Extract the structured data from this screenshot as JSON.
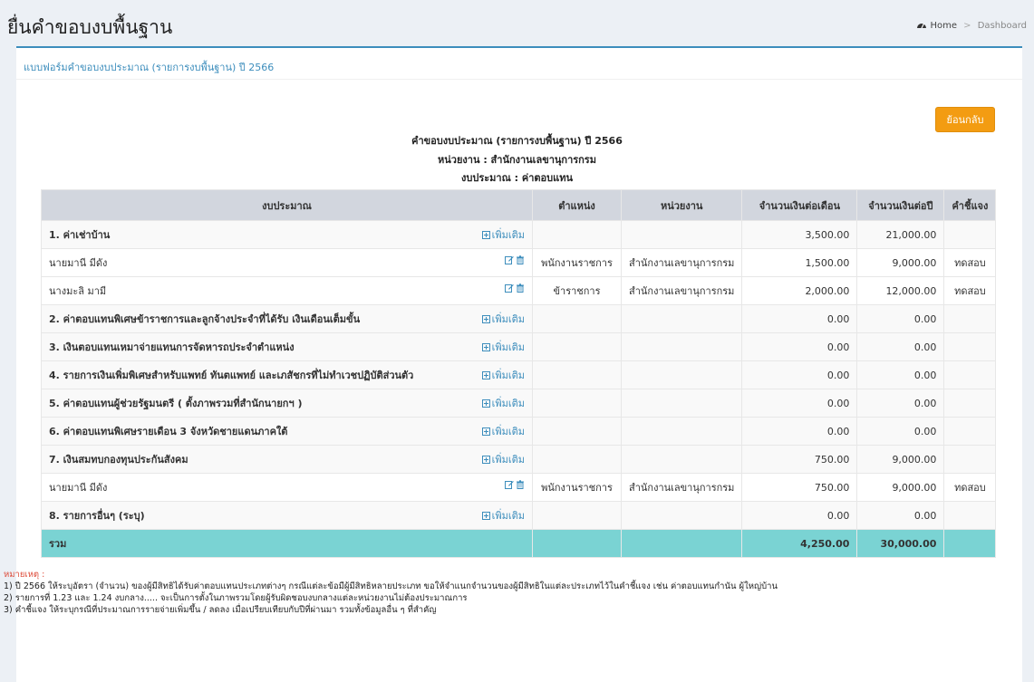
{
  "page": {
    "title": "ยื่นคำขอบงบพื้นฐาน"
  },
  "breadcrumb": {
    "home": "Home",
    "current": "Dashboard"
  },
  "card": {
    "header": "แบบฟอร์มคำขอบงบประมาณ (รายการงบพื้นฐาน) ปี 2566",
    "back_button": "ย้อนกลับ"
  },
  "report": {
    "title": "คำขอบงบประมาณ (รายการงบพื้นฐาน) ปี 2566",
    "unit": "หน่วยงาน : สำนักงานเลขานุการกรม",
    "budget": "งบประมาณ : ค่าตอบแทน"
  },
  "table": {
    "headers": {
      "budget": "งบประมาณ",
      "position": "ตำแหน่ง",
      "unit": "หน่วยงาน",
      "monthly": "จำนวนเงินต่อเดือน",
      "yearly": "จำนวนเงินต่อปี",
      "note": "คำชี้แจง"
    },
    "add_label": "เพิ่มเติม",
    "rows": [
      {
        "name": "1. ค่าเช่าบ้าน",
        "monthly": "3,500.00",
        "yearly": "21,000.00"
      },
      {
        "name": "นายมานี มีดัง",
        "position": "พนักงานราชการ",
        "unit": "สำนักงานเลขานุการกรม",
        "monthly": "1,500.00",
        "yearly": "9,000.00",
        "note": "ทดสอบ"
      },
      {
        "name": "นางมะลิ มามี",
        "position": "ข้าราชการ",
        "unit": "สำนักงานเลขานุการกรม",
        "monthly": "2,000.00",
        "yearly": "12,000.00",
        "note": "ทดสอบ"
      },
      {
        "name": "2. ค่าตอบแทนพิเศษข้าราชการและลูกจ้างประจำที่ได้รับ เงินเดือนเต็มขั้น",
        "monthly": "0.00",
        "yearly": "0.00"
      },
      {
        "name": "3. เงินตอบแทนเหมาจ่ายแทนการจัดหารถประจำตำแหน่ง",
        "monthly": "0.00",
        "yearly": "0.00"
      },
      {
        "name": "4. รายการเงินเพิ่มพิเศษสำหรับแพทย์ ทันตแพทย์ และเภสัชกรที่ไม่ทำเวชปฏิบัติส่วนตัว",
        "monthly": "0.00",
        "yearly": "0.00"
      },
      {
        "name": "5. ค่าตอบแทนผู้ช่วยรัฐมนตรี ( ตั้งภาพรวมที่สำนักนายกฯ )",
        "monthly": "0.00",
        "yearly": "0.00"
      },
      {
        "name": "6. ค่าตอบแทนพิเศษรายเดือน 3 จังหวัดชายแดนภาคใต้",
        "monthly": "0.00",
        "yearly": "0.00"
      },
      {
        "name": "7. เงินสมทบกองทุนประกันสังคม",
        "monthly": "750.00",
        "yearly": "9,000.00"
      },
      {
        "name": "นายมานี มีดัง",
        "position": "พนักงานราชการ",
        "unit": "สำนักงานเลขานุการกรม",
        "monthly": "750.00",
        "yearly": "9,000.00",
        "note": "ทดสอบ"
      },
      {
        "name": "8. รายการอื่นๆ (ระบุ)",
        "monthly": "0.00",
        "yearly": "0.00"
      }
    ],
    "total": {
      "label": "รวม",
      "monthly": "4,250.00",
      "yearly": "30,000.00"
    }
  },
  "notes": {
    "label": "หมายเหตุ :",
    "lines": [
      "1) ปี 2566 ให้ระบุอัตรา (จำนวน) ของผู้มีสิทธิได้รับค่าตอบแทนประเภทต่างๆ กรณีแต่ละข้อมีผู้มีสิทธิหลายประเภท ขอให้จำแนกจำนวนของผู้มีสิทธิในแต่ละประเภทไว้ในคำชี้แจง เช่น ค่าตอบแทนกำนัน ผู้ใหญ่บ้าน",
      "2) รายการที่ 1.23 และ 1.24 งบกลาง..... จะเป็นการตั้งในภาพรวมโดยผู้รับผิดชอบงบกลางแต่ละหน่วยงานไม่ต้องประมาณการ",
      "3) คำชี้แจง ให้ระบุกรณีที่ประมาณการรายจ่ายเพิ่มขึ้น / ลดลง เมื่อเปรียบเทียบกับปีที่ผ่านมา รวมทั้งข้อมูลอื่น ๆ ที่สำคัญ"
    ]
  }
}
